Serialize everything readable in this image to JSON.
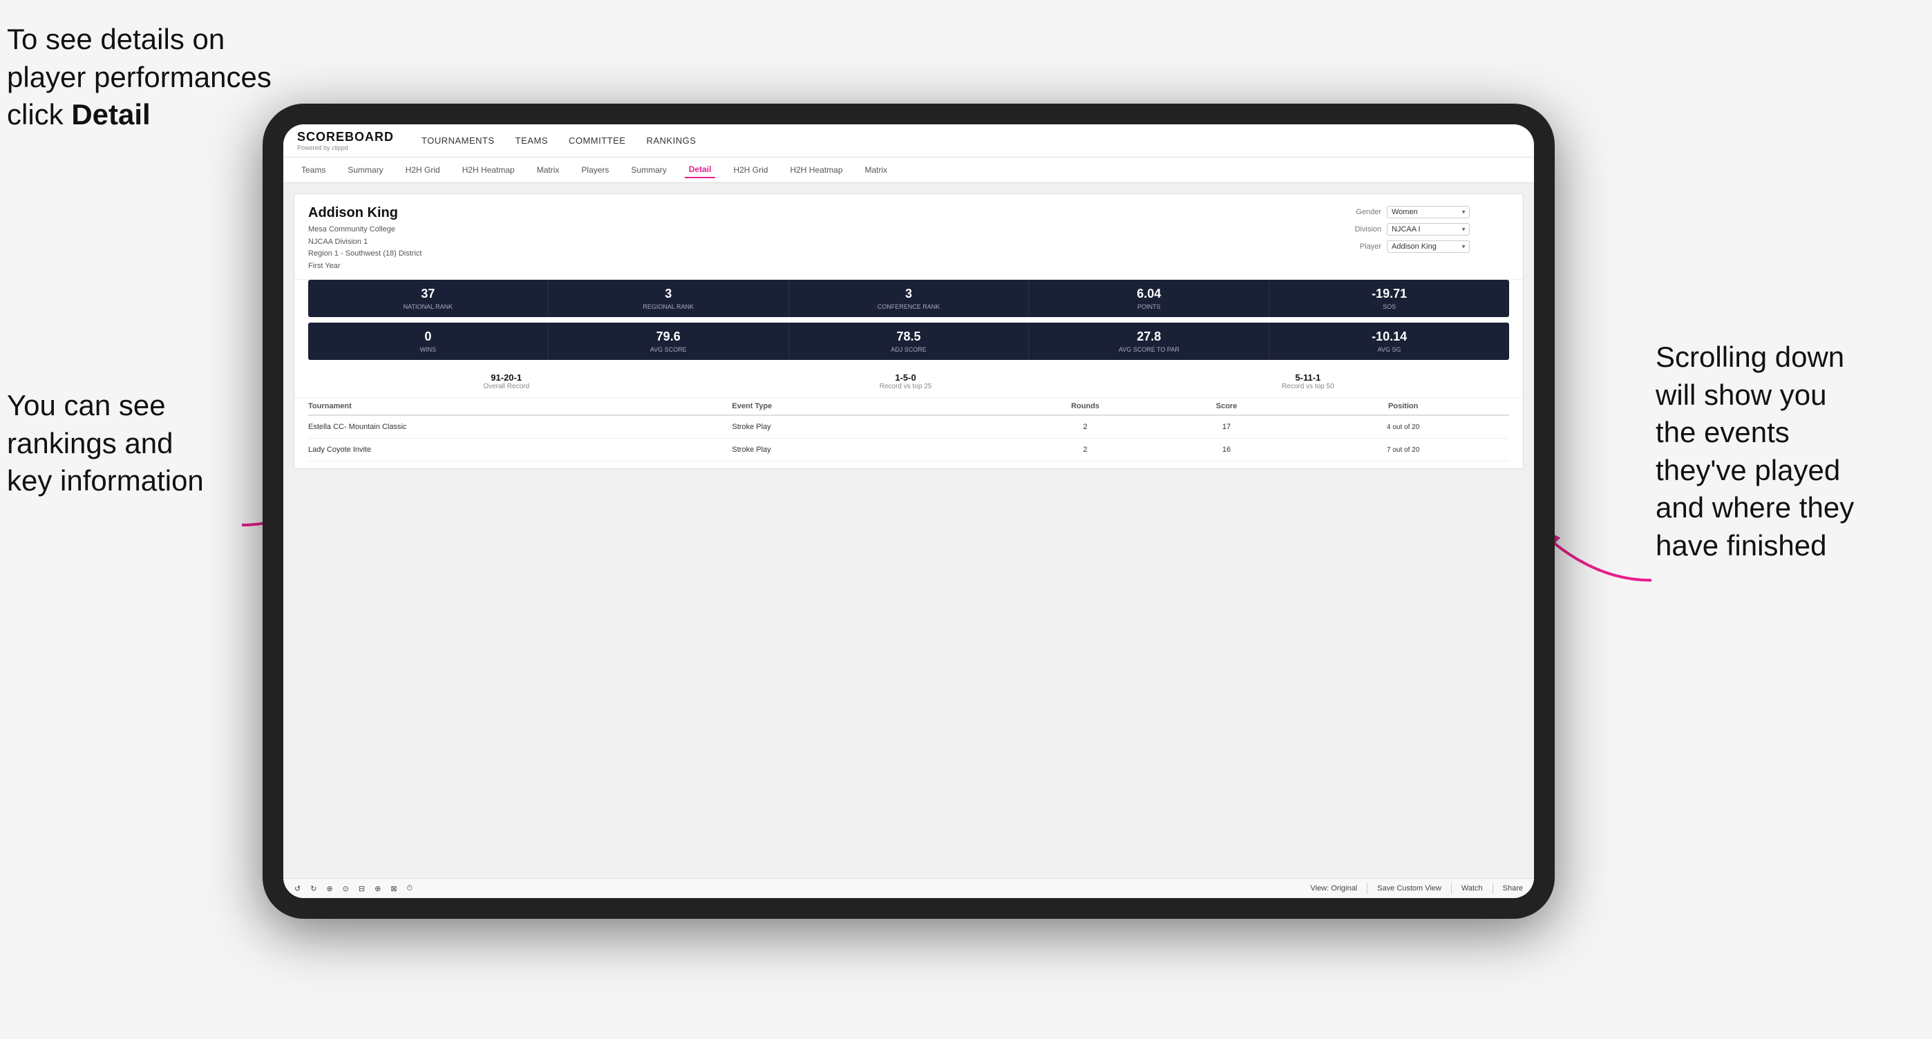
{
  "annotations": {
    "top_left": "To see details on player performances click ",
    "top_left_bold": "Detail",
    "bottom_left_line1": "You can see",
    "bottom_left_line2": "rankings and",
    "bottom_left_line3": "key information",
    "bottom_right_line1": "Scrolling down",
    "bottom_right_line2": "will show you",
    "bottom_right_line3": "the events",
    "bottom_right_line4": "they've played",
    "bottom_right_line5": "and where they",
    "bottom_right_line6": "have finished"
  },
  "nav": {
    "logo_title": "SCOREBOARD",
    "logo_sub": "Powered by clippd",
    "items": [
      "TOURNAMENTS",
      "TEAMS",
      "COMMITTEE",
      "RANKINGS"
    ]
  },
  "sub_nav": {
    "items": [
      "Teams",
      "Summary",
      "H2H Grid",
      "H2H Heatmap",
      "Matrix",
      "Players",
      "Summary",
      "Detail",
      "H2H Grid",
      "H2H Heatmap",
      "Matrix"
    ],
    "active": "Detail"
  },
  "player": {
    "name": "Addison King",
    "school": "Mesa Community College",
    "division": "NJCAA Division 1",
    "region": "Region 1 - Southwest (18) District",
    "year": "First Year",
    "gender_label": "Gender",
    "gender_value": "Women",
    "division_label": "Division",
    "division_value": "NJCAA I",
    "player_label": "Player",
    "player_value": "Addison King"
  },
  "stats_row1": [
    {
      "value": "37",
      "label": "National Rank"
    },
    {
      "value": "3",
      "label": "Regional Rank"
    },
    {
      "value": "3",
      "label": "Conference Rank"
    },
    {
      "value": "6.04",
      "label": "Points"
    },
    {
      "value": "-19.71",
      "label": "SoS"
    }
  ],
  "stats_row2": [
    {
      "value": "0",
      "label": "Wins"
    },
    {
      "value": "79.6",
      "label": "Avg Score"
    },
    {
      "value": "78.5",
      "label": "Adj Score"
    },
    {
      "value": "27.8",
      "label": "Avg Score to Par"
    },
    {
      "value": "-10.14",
      "label": "Avg SG"
    }
  ],
  "records": [
    {
      "value": "91-20-1",
      "label": "Overall Record"
    },
    {
      "value": "1-5-0",
      "label": "Record vs top 25"
    },
    {
      "value": "5-11-1",
      "label": "Record vs top 50"
    }
  ],
  "table": {
    "headers": [
      "Tournament",
      "Event Type",
      "Rounds",
      "Score",
      "Position"
    ],
    "rows": [
      {
        "tournament": "Estella CC- Mountain Classic",
        "event_type": "Stroke Play",
        "rounds": "2",
        "score": "17",
        "position": "4 out of 20"
      },
      {
        "tournament": "Lady Coyote Invite",
        "event_type": "Stroke Play",
        "rounds": "2",
        "score": "16",
        "position": "7 out of 20"
      }
    ]
  },
  "toolbar": {
    "buttons": [
      "↺",
      "↻",
      "⊕",
      "⊙",
      "⊟",
      "⊕",
      "⊠",
      "⏱"
    ],
    "view_original": "View: Original",
    "save_custom": "Save Custom View",
    "watch": "Watch",
    "share": "Share"
  }
}
